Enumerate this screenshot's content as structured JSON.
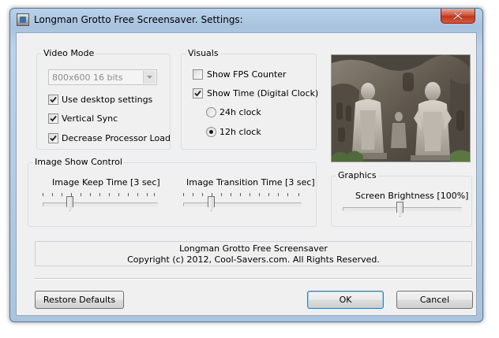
{
  "window": {
    "title": "Longman Grotto Free Screensaver. Settings:"
  },
  "video_mode": {
    "group_label": "Video Mode",
    "resolution_value": "800x600 16 bits",
    "use_desktop_settings": {
      "label": "Use desktop settings",
      "checked": true
    },
    "vertical_sync": {
      "label": "Vertical Sync",
      "checked": true
    },
    "decrease_processor_load": {
      "label": "Decrease Processor Load",
      "checked": true
    }
  },
  "visuals": {
    "group_label": "Visuals",
    "show_fps_counter": {
      "label": "Show FPS Counter",
      "checked": false
    },
    "show_time": {
      "label": "Show Time (Digital Clock)",
      "checked": true
    },
    "clock_24h": {
      "label": "24h clock",
      "selected": false
    },
    "clock_12h": {
      "label": "12h clock",
      "selected": true
    }
  },
  "image_show_control": {
    "group_label": "Image Show Control",
    "keep_time": {
      "label": "Image Keep Time [3 sec]",
      "position": 0.22
    },
    "transition_time": {
      "label": "Image Transition Time [3 sec]",
      "position": 0.22
    }
  },
  "graphics": {
    "group_label": "Graphics",
    "brightness": {
      "label": "Screen Brightness [100%]",
      "position": 0.5
    }
  },
  "info": {
    "line1": "Longman Grotto Free Screensaver",
    "line2": "Copyright (c) 2012, Cool-Savers.com. All Rights Reserved."
  },
  "buttons": {
    "restore_defaults": "Restore Defaults",
    "ok": "OK",
    "cancel": "Cancel"
  },
  "colors": {
    "title_bar": "#b9d1ea",
    "close_button": "#c94a30",
    "dialog_background": "#f0f0f0",
    "default_button_border": "#3c7fb1"
  }
}
